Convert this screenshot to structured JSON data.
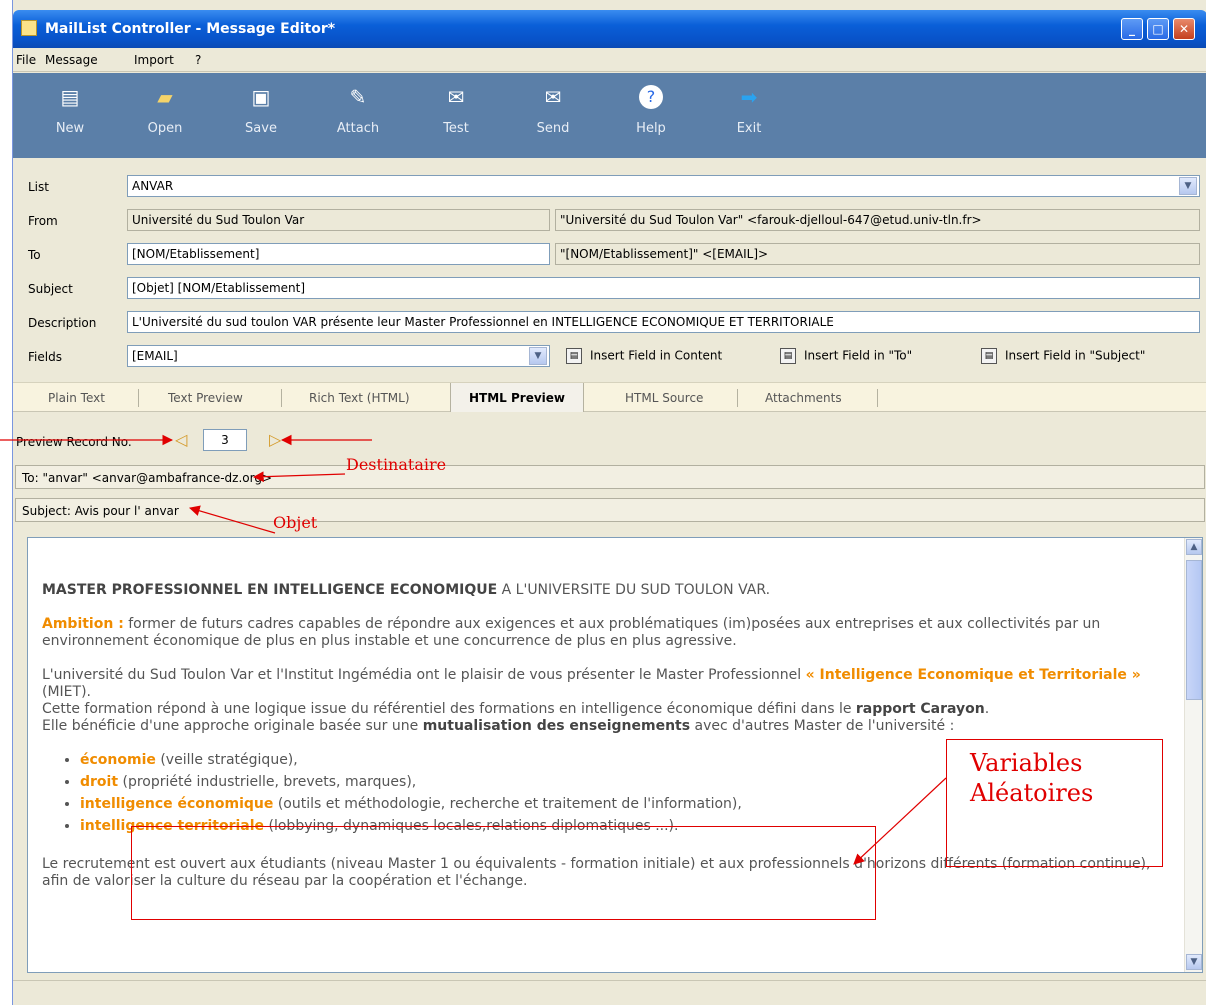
{
  "window": {
    "title": "MailList Controller - Message Editor*"
  },
  "menu": [
    "File",
    "Message",
    "Import",
    "?"
  ],
  "toolbar": [
    {
      "label": "New",
      "icon": "new-document-icon"
    },
    {
      "label": "Open",
      "icon": "open-folder-icon"
    },
    {
      "label": "Save",
      "icon": "save-disk-icon"
    },
    {
      "label": "Attach",
      "icon": "paperclip-icon"
    },
    {
      "label": "Test",
      "icon": "test-mail-icon"
    },
    {
      "label": "Send",
      "icon": "send-mail-icon"
    },
    {
      "label": "Help",
      "icon": "help-icon"
    },
    {
      "label": "Exit",
      "icon": "exit-arrow-icon"
    }
  ],
  "form": {
    "list_label": "List",
    "list_value": "ANVAR",
    "from_label": "From",
    "from_value": "Université du Sud Toulon Var",
    "from_preview": "\"Université du Sud Toulon Var\" <farouk-djelloul-647@etud.univ-tln.fr>",
    "to_label": "To",
    "to_value": "[NOM/Etablissement]",
    "to_preview": "\"[NOM/Etablissement]\" <[EMAIL]>",
    "subject_label": "Subject",
    "subject_value": "[Objet] [NOM/Etablissement]",
    "description_label": "Description",
    "description_value": "L'Université du sud toulon VAR présente leur Master Professionnel en INTELLIGENCE ECONOMIQUE ET TERRITORIALE",
    "fields_label": "Fields",
    "fields_value": "[EMAIL]",
    "insert_content": "Insert Field in Content",
    "insert_to": "Insert Field in \"To\"",
    "insert_subject": "Insert Field in \"Subject\""
  },
  "tabs": [
    "Plain Text",
    "Text Preview",
    "Rich Text (HTML)",
    "HTML Preview",
    "HTML Source",
    "Attachments"
  ],
  "active_tab": "HTML Preview",
  "preview": {
    "record_label": "Preview Record No.",
    "record_no": "3",
    "to_line": "To: \"anvar\" <anvar@ambafrance-dz.org>",
    "subject_line": "Subject: Avis pour l' anvar"
  },
  "message": {
    "p1_bold": "MASTER PROFESSIONNEL EN INTELLIGENCE ECONOMIQUE",
    "p1_rest": " A L'UNIVERSITE DU SUD TOULON VAR.",
    "ambition_label": "Ambition :",
    "ambition_text": " former de futurs cadres capables de répondre aux exigences et aux problématiques (im)posées aux entreprises et aux collectivités par un environnement économique de plus en plus instable et une concurrence de plus en plus agressive.",
    "p3a": "L'université du Sud Toulon Var et l'Institut Ingémédia ont le plaisir de vous présenter le Master Professionnel ",
    "p3_master": "« Intelligence Economique et Territoriale »",
    "p3b": " (MIET).",
    "p3c": "Cette formation répond à une logique issue du référentiel des formations en intelligence économique défini dans le ",
    "p3_rapport": "rapport Carayon",
    "p3d": ".",
    "p3e": "Elle bénéficie d'une approche originale basée sur une ",
    "p3_mutual": "mutualisation des enseignements",
    "p3f": " avec d'autres Master de l'université :",
    "list": [
      {
        "term": "économie",
        "desc": " (veille stratégique),"
      },
      {
        "term": "droit",
        "desc": " (propriété industrielle, brevets, marques),"
      },
      {
        "term": "intelligence économique",
        "desc": " (outils et méthodologie, recherche et traitement de l'information),"
      },
      {
        "term": "intelligence territoriale",
        "desc": " (lobbying, dynamiques locales,relations diplomatiques ...)."
      }
    ],
    "p4": "Le recrutement est ouvert aux étudiants (niveau Master 1 ou équivalents - formation initiale) et aux professionnels d'horizons différents (formation continue), afin de valoriser la culture du réseau par la coopération et l'échange."
  },
  "annotations": {
    "destinataire": "Destinataire",
    "objet": "Objet",
    "variables_line1": "Variables",
    "variables_line2": "Aléatoires"
  }
}
